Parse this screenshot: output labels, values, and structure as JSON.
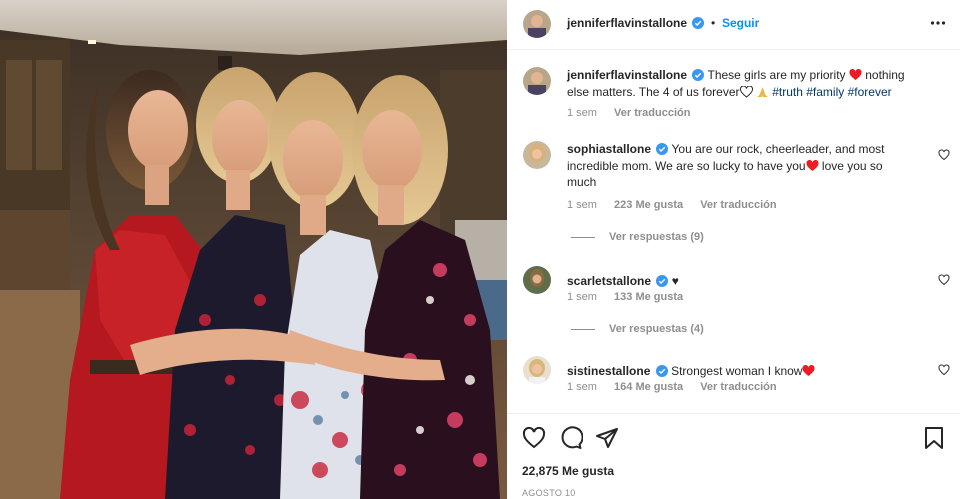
{
  "post": {
    "author": "jenniferflavinstallone",
    "follow_label": "Seguir",
    "caption": {
      "text_before": "These girls are my priority",
      "text_middle": "nothing else matters. The 4 of us forever",
      "hashtags": [
        "#truth",
        "#family",
        "#forever"
      ],
      "time": "1 sem",
      "translate_label": "Ver traducción"
    },
    "likes": "22,875 Me gusta",
    "date": "AGOSTO 10"
  },
  "comments": [
    {
      "user": "sophiastallone",
      "text_a": "You are our rock, cheerleader, and most incredible mom. We are so lucky to have you",
      "text_b": "love you so much",
      "time": "1 sem",
      "likes": "223 Me gusta",
      "translate_label": "Ver traducción",
      "replies": "Ver respuestas (9)"
    },
    {
      "user": "scarletstallone",
      "text_a": "♥",
      "time": "1 sem",
      "likes": "133 Me gusta",
      "replies": "Ver respuestas (4)"
    },
    {
      "user": "sistinestallone",
      "text_a": "Strongest woman I know",
      "time": "1 sem",
      "likes": "164 Me gusta",
      "translate_label": "Ver traducción"
    }
  ],
  "icons": {
    "verified": "verified-badge-icon",
    "heart": "heart-icon",
    "comment": "comment-icon",
    "share": "share-icon",
    "save": "bookmark-icon",
    "more": "more-options-icon"
  },
  "colors": {
    "accent": "#0095f6",
    "verified": "#3897f0",
    "heart_emoji": "#ed1c24",
    "hashtag": "#00376b",
    "muted": "#8e8e8e"
  }
}
